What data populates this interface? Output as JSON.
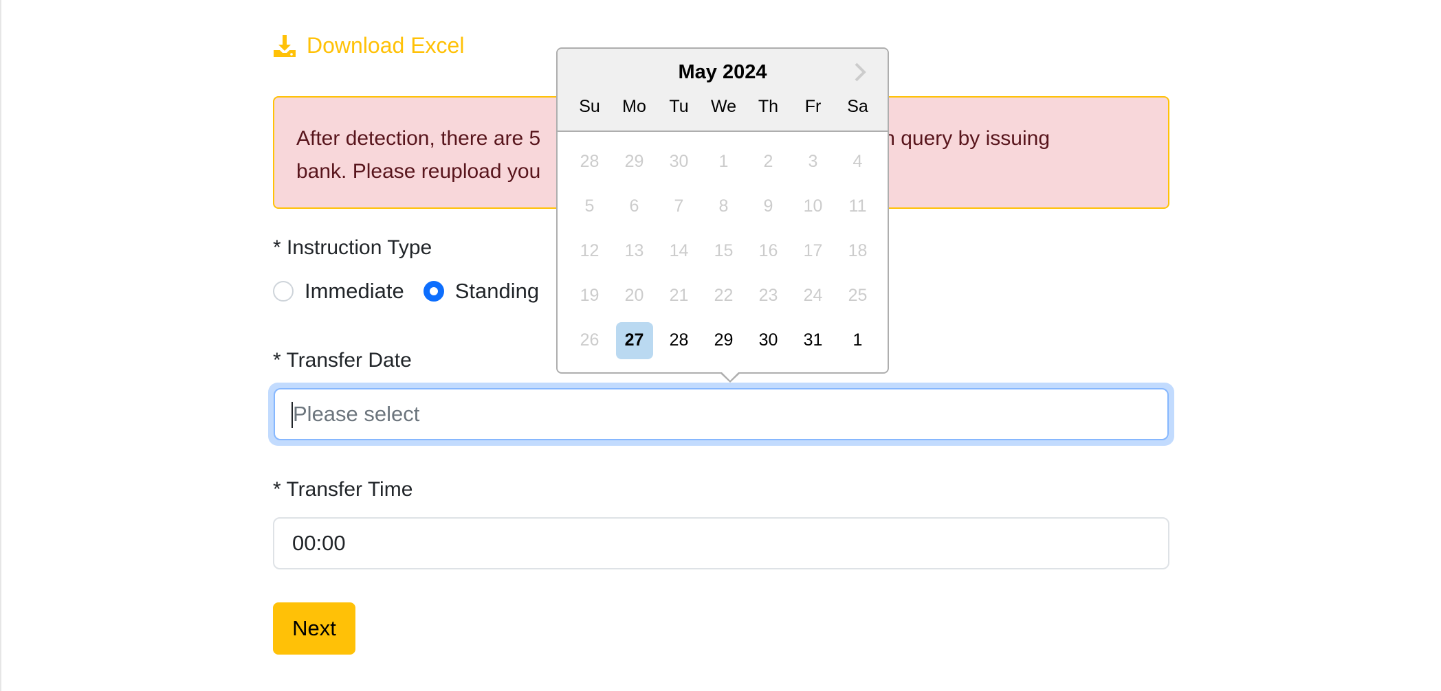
{
  "download": {
    "label": "Download Excel",
    "icon": "download-icon"
  },
  "alert": {
    "line1": "After detection, there are 5",
    "line1_right": "match query by issuing",
    "line2": "bank. Please reupload you"
  },
  "instruction": {
    "label": "* Instruction Type",
    "options": [
      {
        "label": "Immediate",
        "checked": false
      },
      {
        "label": "Standing",
        "checked": true
      }
    ]
  },
  "transfer_date": {
    "label": "* Transfer Date",
    "placeholder": "Please select",
    "value": ""
  },
  "transfer_time": {
    "label": "* Transfer Time",
    "value": "00:00"
  },
  "next_button": "Next",
  "datepicker": {
    "month_label": "May 2024",
    "day_names": [
      "Su",
      "Mo",
      "Tu",
      "We",
      "Th",
      "Fr",
      "Sa"
    ],
    "weeks": [
      [
        "28",
        "29",
        "30",
        "1",
        "2",
        "3",
        "4"
      ],
      [
        "5",
        "6",
        "7",
        "8",
        "9",
        "10",
        "11"
      ],
      [
        "12",
        "13",
        "14",
        "15",
        "16",
        "17",
        "18"
      ],
      [
        "19",
        "20",
        "21",
        "22",
        "23",
        "24",
        "25"
      ],
      [
        "26",
        "27",
        "28",
        "29",
        "30",
        "31",
        "1"
      ]
    ],
    "today": "27",
    "colors": {
      "accent": "#ffc107",
      "selected_bg": "#bad9f1",
      "primary": "#0d6efd"
    }
  }
}
